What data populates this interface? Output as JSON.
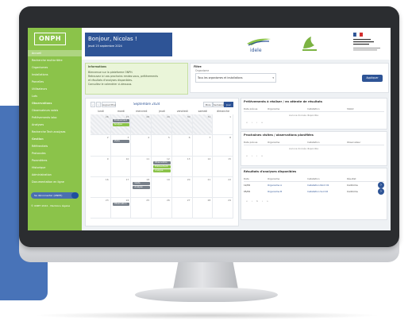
{
  "sidebar": {
    "logo": "ONPH",
    "items": [
      {
        "label": "Accueil"
      },
      {
        "label": "Recherche multicritère"
      },
      {
        "label": "Organismes"
      },
      {
        "label": "Installations"
      },
      {
        "label": "Parcelles"
      },
      {
        "label": "Utilisateurs"
      },
      {
        "label": "Lots"
      },
      {
        "label": "Observations"
      },
      {
        "label": "Observateurs saisis"
      },
      {
        "label": "Prélèvements labo"
      },
      {
        "label": "Analyses"
      },
      {
        "label": "Recherche Tech analyses"
      },
      {
        "label": "Gestion"
      },
      {
        "label": "Référentiels"
      },
      {
        "label": "Protocoles"
      },
      {
        "label": "Paramètres"
      },
      {
        "label": "Historique"
      },
      {
        "label": "Administration"
      },
      {
        "label": "Documentation en ligne"
      }
    ],
    "user_pill": "Se déconnecter (ONPH)",
    "footer": "© ONPH 2024 - Mentions légales"
  },
  "header": {
    "greeting": "Bonjour, Nicolas !",
    "date": "Jeudi 25 septembre 2024",
    "logos": [
      {
        "name": "idele",
        "text": "idele"
      },
      {
        "name": "agriculture-bio"
      },
      {
        "name": "republique-francaise"
      }
    ]
  },
  "info": {
    "title": "Informations",
    "line1": "Bienvenue sur la plateforme ONPH.",
    "line2": "Retrouvez ici vos prochains rendez-vous, prélèvements",
    "line3": "et résultats d'analyses disponibles.",
    "line4": "Consultez le calendrier ci-dessous."
  },
  "selector": {
    "label": "Filtre",
    "field_label": "Organisme",
    "value": "Tous les organismes et installations",
    "button": "Appliquer"
  },
  "calendar": {
    "prev": "‹",
    "next": "›",
    "today": "Aujourd'hui",
    "month": "Septembre 2024",
    "views": [
      "Mois",
      "Semaine",
      "Jour"
    ],
    "days": [
      "lundi",
      "mardi",
      "mercredi",
      "jeudi",
      "vendredi",
      "samedi",
      "dimanche"
    ],
    "weeks": [
      [
        "26",
        "27",
        "28",
        "29",
        "30",
        "31",
        "1"
      ],
      [
        "2",
        "3",
        "4",
        "5",
        "6",
        "7",
        "8"
      ],
      [
        "9",
        "10",
        "11",
        "12",
        "13",
        "14",
        "15"
      ],
      [
        "16",
        "17",
        "18",
        "19",
        "20",
        "21",
        "22"
      ],
      [
        "23",
        "24",
        "25",
        "26",
        "27",
        "28",
        "29"
      ]
    ],
    "events": [
      {
        "week": 0,
        "day": 1,
        "label": "Prélèvement",
        "kind": "d"
      },
      {
        "week": 0,
        "day": 1,
        "label": "Analyse",
        "kind": "g"
      },
      {
        "week": 1,
        "day": 1,
        "label": "Visite",
        "kind": "d"
      },
      {
        "week": 2,
        "day": 3,
        "label": "Observation",
        "kind": "d"
      },
      {
        "week": 2,
        "day": 3,
        "label": "Prélèvement",
        "kind": "g"
      },
      {
        "week": 2,
        "day": 3,
        "label": "Analyse",
        "kind": "g"
      },
      {
        "week": 3,
        "day": 2,
        "label": "Visite",
        "kind": "d"
      },
      {
        "week": 3,
        "day": 2,
        "label": "Analyse",
        "kind": "d"
      },
      {
        "week": 4,
        "day": 1,
        "label": "Observation",
        "kind": "d"
      }
    ]
  },
  "panels": [
    {
      "title": "Prélèvements à réaliser / en attente de résultats",
      "columns": [
        "Date prévue",
        "Organisme",
        "Installation",
        "Statut"
      ],
      "empty": "Aucune donnée disponible",
      "pager": "« ‹ › »"
    },
    {
      "title": "Prochaines visites / observations planifiées",
      "columns": [
        "Date prévue",
        "Organisme",
        "Installation",
        "Observateur"
      ],
      "empty": "Aucune donnée disponible",
      "pager": "« ‹ › »"
    },
    {
      "title": "Résultats d'analyses disponibles",
      "columns": [
        "Date",
        "Organisme",
        "Installation",
        "Résultat"
      ],
      "rows": [
        [
          "12/09",
          "Organisme A",
          "Installation Nord 01",
          "Conforme"
        ],
        [
          "05/09",
          "Organisme B",
          "Installation Sud 02",
          "Conforme"
        ]
      ],
      "pager": "« ‹ 1 › »"
    }
  ]
}
